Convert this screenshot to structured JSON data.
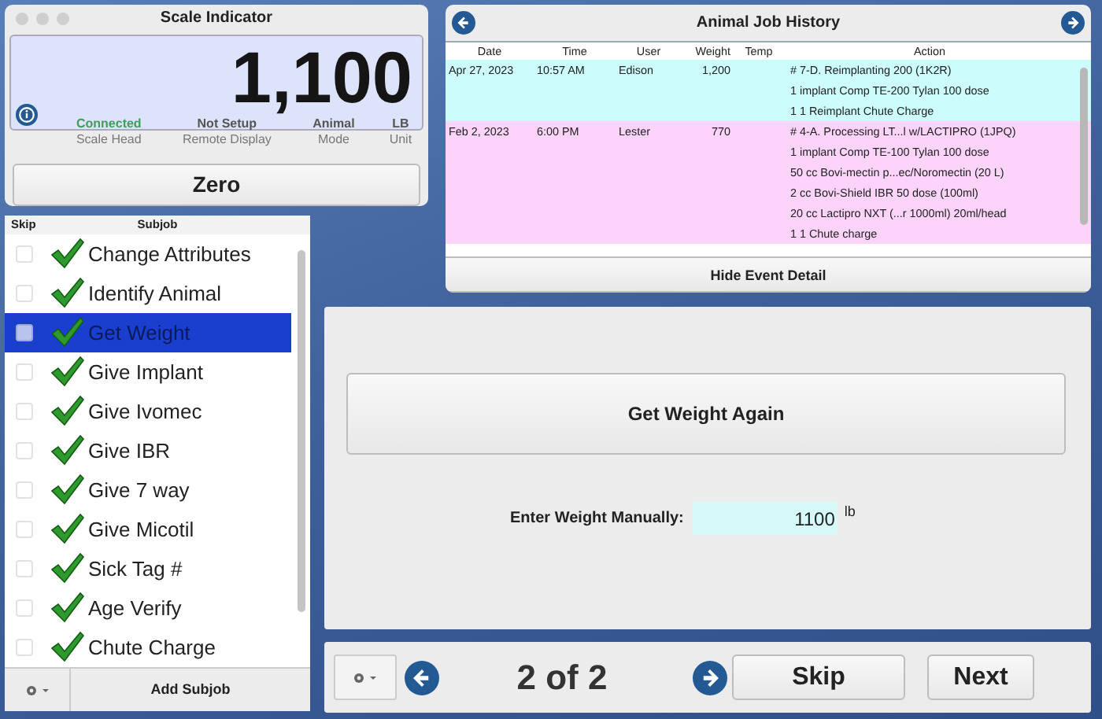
{
  "scale": {
    "title": "Scale Indicator",
    "reading": "1,100",
    "statuses": [
      {
        "value": "Connected",
        "label": "Scale Head",
        "ok": true
      },
      {
        "value": "Not Setup",
        "label": "Remote Display",
        "ok": false
      },
      {
        "value": "Animal",
        "label": "Mode",
        "ok": false
      },
      {
        "value": "LB",
        "label": "Unit",
        "ok": false
      }
    ],
    "zero_button": "Zero"
  },
  "subjobs": {
    "columns": [
      "Skip",
      "Subjob"
    ],
    "items": [
      {
        "label": "Change Attributes",
        "skip": false,
        "done": true,
        "selected": false
      },
      {
        "label": "Identify Animal",
        "skip": false,
        "done": true,
        "selected": false
      },
      {
        "label": "Get Weight",
        "skip": false,
        "done": true,
        "selected": true
      },
      {
        "label": "Give Implant",
        "skip": false,
        "done": true,
        "selected": false
      },
      {
        "label": "Give Ivomec",
        "skip": false,
        "done": true,
        "selected": false
      },
      {
        "label": "Give IBR",
        "skip": false,
        "done": true,
        "selected": false
      },
      {
        "label": "Give 7 way",
        "skip": false,
        "done": true,
        "selected": false
      },
      {
        "label": "Give Micotil",
        "skip": false,
        "done": true,
        "selected": false
      },
      {
        "label": "Sick Tag #",
        "skip": false,
        "done": true,
        "selected": false
      },
      {
        "label": "Age Verify",
        "skip": false,
        "done": true,
        "selected": false
      },
      {
        "label": "Chute Charge",
        "skip": false,
        "done": true,
        "selected": false
      }
    ],
    "add_button": "Add Subjob"
  },
  "history": {
    "title": "Animal Job History",
    "columns": [
      "Date",
      "Time",
      "User",
      "Weight",
      "Temp",
      "Action"
    ],
    "rows": [
      {
        "date": "Apr 27, 2023",
        "time": "10:57 AM",
        "user": "Edison",
        "weight": "1,200",
        "color": "#ccfcfc",
        "actions": [
          "# 7-D. Reimplanting 200 (1K2R)",
          "1 implant Comp TE-200 Tylan 100 dose",
          "1 1 Reimplant Chute Charge"
        ]
      },
      {
        "date": "Feb 2, 2023",
        "time": "6:00 PM",
        "user": "Lester",
        "weight": "770",
        "color": "#fcd4fa",
        "actions": [
          "# 4-A. Processing LT...l w/LACTIPRO (1JPQ)",
          "1 implant Comp TE-100 Tylan 100 dose",
          "50 cc Bovi-mectin p...ec/Noromectin (20 L)",
          "2 cc Bovi-Shield IBR 50 dose (100ml)",
          "20 cc Lactipro NXT (...r 1000ml) 20ml/head",
          "1 1 Chute charge"
        ]
      }
    ],
    "hide_button": "Hide Event Detail"
  },
  "main": {
    "action_button": "Get Weight Again",
    "manual_label": "Enter Weight Manually:",
    "manual_value": "1100",
    "unit": "lb"
  },
  "footer": {
    "page": "2 of 2",
    "skip_button": "Skip",
    "next_button": "Next"
  }
}
